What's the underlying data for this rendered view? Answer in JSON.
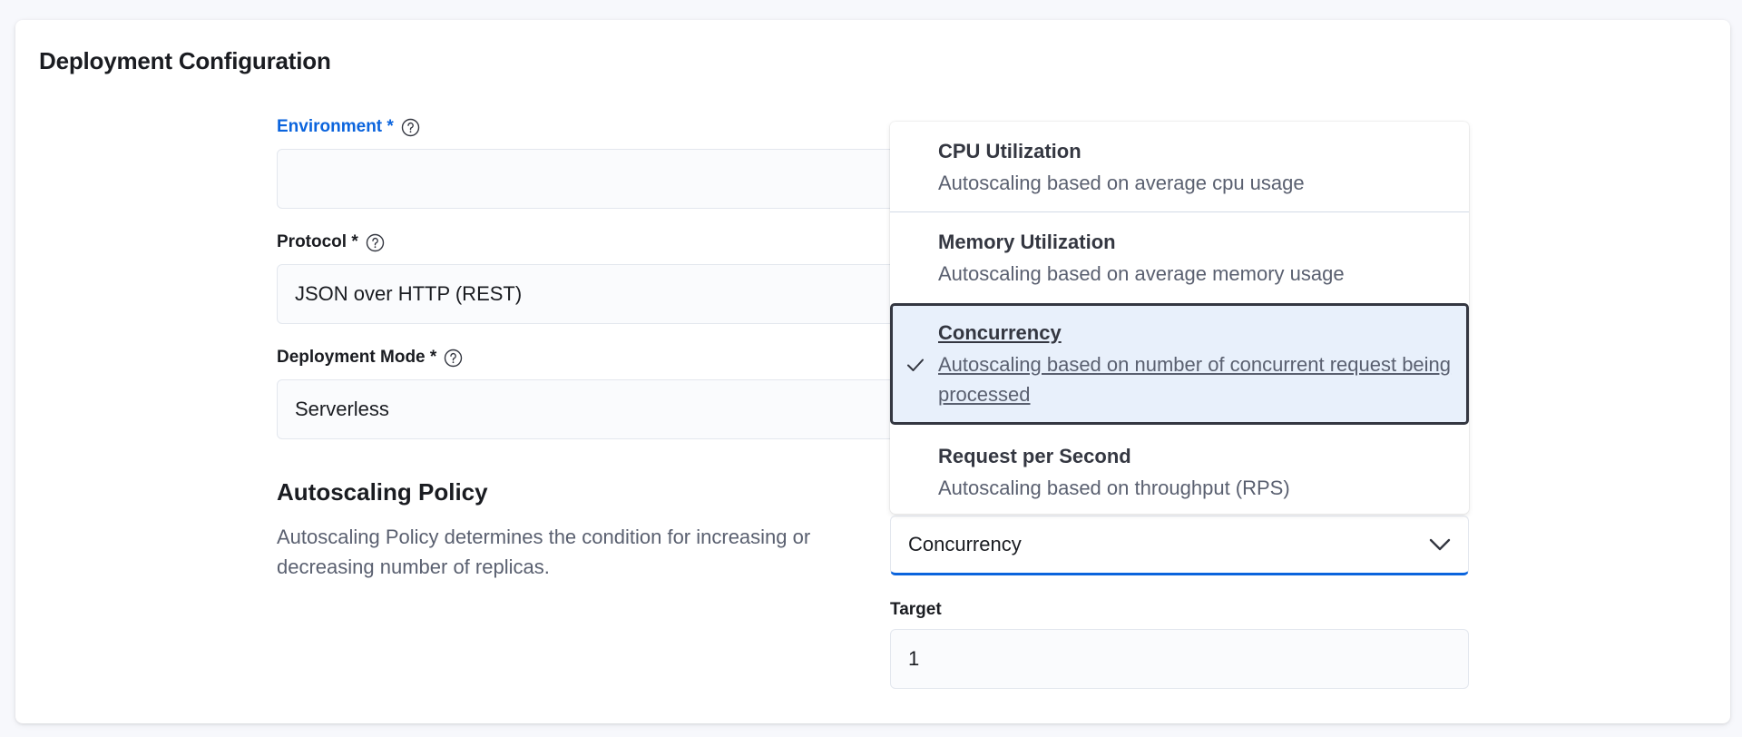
{
  "panel": {
    "title": "Deployment Configuration"
  },
  "form": {
    "environment": {
      "label": "Environment *",
      "value": ""
    },
    "protocol": {
      "label": "Protocol *",
      "value": "JSON over HTTP (REST)"
    },
    "deployment_mode": {
      "label": "Deployment Mode *",
      "value": "Serverless"
    }
  },
  "autoscaling": {
    "title": "Autoscaling Policy",
    "description": "Autoscaling Policy determines the condition for increasing or decreasing number of replicas.",
    "selected_value": "Concurrency",
    "options": [
      {
        "title": "CPU Utilization",
        "description": "Autoscaling based on average cpu usage"
      },
      {
        "title": "Memory Utilization",
        "description": "Autoscaling based on average memory usage"
      },
      {
        "title": "Concurrency",
        "description": "Autoscaling based on number of concurrent request being processed"
      },
      {
        "title": "Request per Second",
        "description": "Autoscaling based on throughput (RPS)"
      }
    ],
    "target": {
      "label": "Target",
      "value": "1"
    }
  },
  "icons": {
    "help": "question-circle-icon",
    "check": "check-icon",
    "chevron": "chevron-down-icon"
  },
  "colors": {
    "accent": "#0b64dd",
    "selected_bg": "#e8f0fb",
    "selected_border": "#343741"
  }
}
